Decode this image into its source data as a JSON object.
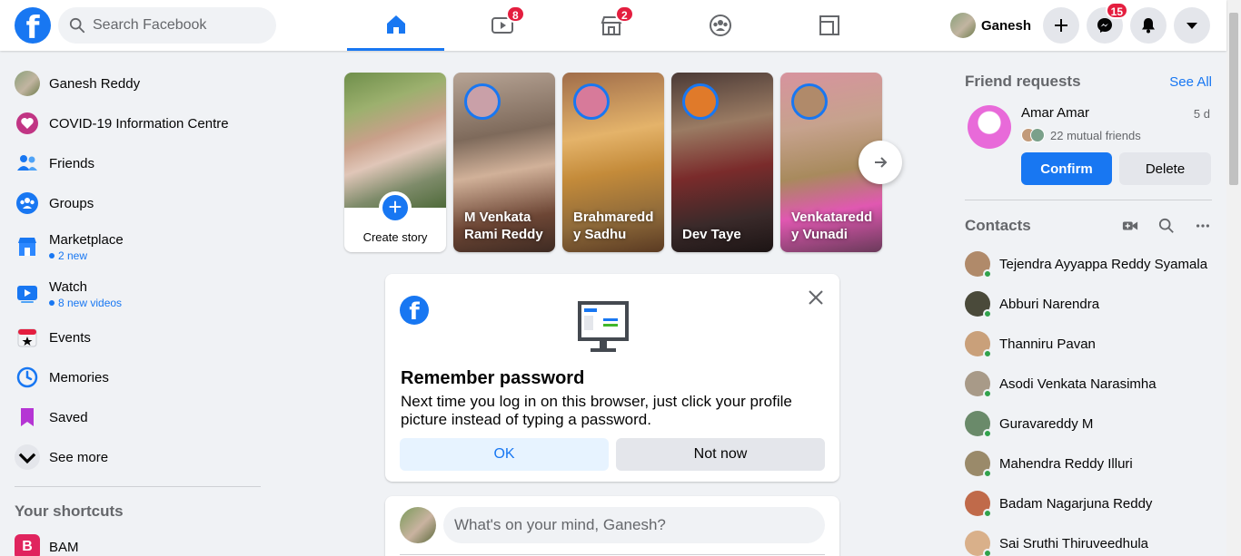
{
  "header": {
    "logo_letter": "f",
    "search_placeholder": "Search Facebook",
    "nav": [
      {
        "name": "home",
        "badge": ""
      },
      {
        "name": "watch",
        "badge": "8"
      },
      {
        "name": "marketplace",
        "badge": "2"
      },
      {
        "name": "groups",
        "badge": ""
      },
      {
        "name": "gaming",
        "badge": ""
      }
    ],
    "profile_name": "Ganesh",
    "messenger_badge": "15",
    "accent": "#1877f2"
  },
  "sidebar": {
    "items": [
      {
        "label": "Ganesh Reddy",
        "icon": "profile-avatar"
      },
      {
        "label": "COVID-19 Information Centre",
        "icon": "heart-icon"
      },
      {
        "label": "Friends",
        "icon": "friends-icon"
      },
      {
        "label": "Groups",
        "icon": "groups-icon"
      },
      {
        "label": "Marketplace",
        "icon": "shop-icon",
        "sub": "2 new"
      },
      {
        "label": "Watch",
        "icon": "video-icon",
        "sub": "8 new videos"
      },
      {
        "label": "Events",
        "icon": "calendar-icon"
      },
      {
        "label": "Memories",
        "icon": "clock-icon"
      },
      {
        "label": "Saved",
        "icon": "bookmark-icon"
      },
      {
        "label": "See more",
        "icon": "chevron-down-icon"
      }
    ],
    "shortcuts_title": "Your shortcuts",
    "shortcuts": [
      {
        "label": "BAM",
        "icon": "bam-icon"
      }
    ]
  },
  "stories": {
    "create_label": "Create story",
    "items": [
      {
        "name": "M Venkata Rami Reddy"
      },
      {
        "name": "Brahmaredd y Sadhu"
      },
      {
        "name": "Dev Taye"
      },
      {
        "name": "Venkataredd y Vunadi"
      }
    ]
  },
  "remember_card": {
    "title": "Remember password",
    "body": "Next time you log in on this browser, just click your profile picture instead of typing a password.",
    "ok_label": "OK",
    "not_now_label": "Not now"
  },
  "composer": {
    "placeholder": "What's on your mind, Ganesh?"
  },
  "right": {
    "friend_requests_title": "Friend requests",
    "see_all": "See All",
    "request": {
      "name": "Amar Amar",
      "age": "5 d",
      "mutual": "22 mutual friends",
      "confirm_label": "Confirm",
      "delete_label": "Delete"
    },
    "contacts_title": "Contacts",
    "contacts": [
      {
        "name": "Tejendra Ayyappa Reddy Syamala",
        "color": "#b08a6a"
      },
      {
        "name": "Abburi Narendra",
        "color": "#4a4a3a"
      },
      {
        "name": "Thanniru Pavan",
        "color": "#c9a07a"
      },
      {
        "name": "Asodi Venkata Narasimha",
        "color": "#a89a88"
      },
      {
        "name": "Guravareddy M",
        "color": "#6a8a6a"
      },
      {
        "name": "Mahendra Reddy Illuri",
        "color": "#9a8a6a"
      },
      {
        "name": "Badam Nagarjuna Reddy",
        "color": "#c06a4a"
      },
      {
        "name": "Sai Sruthi Thiruveedhula",
        "color": "#d9b08a"
      }
    ]
  }
}
